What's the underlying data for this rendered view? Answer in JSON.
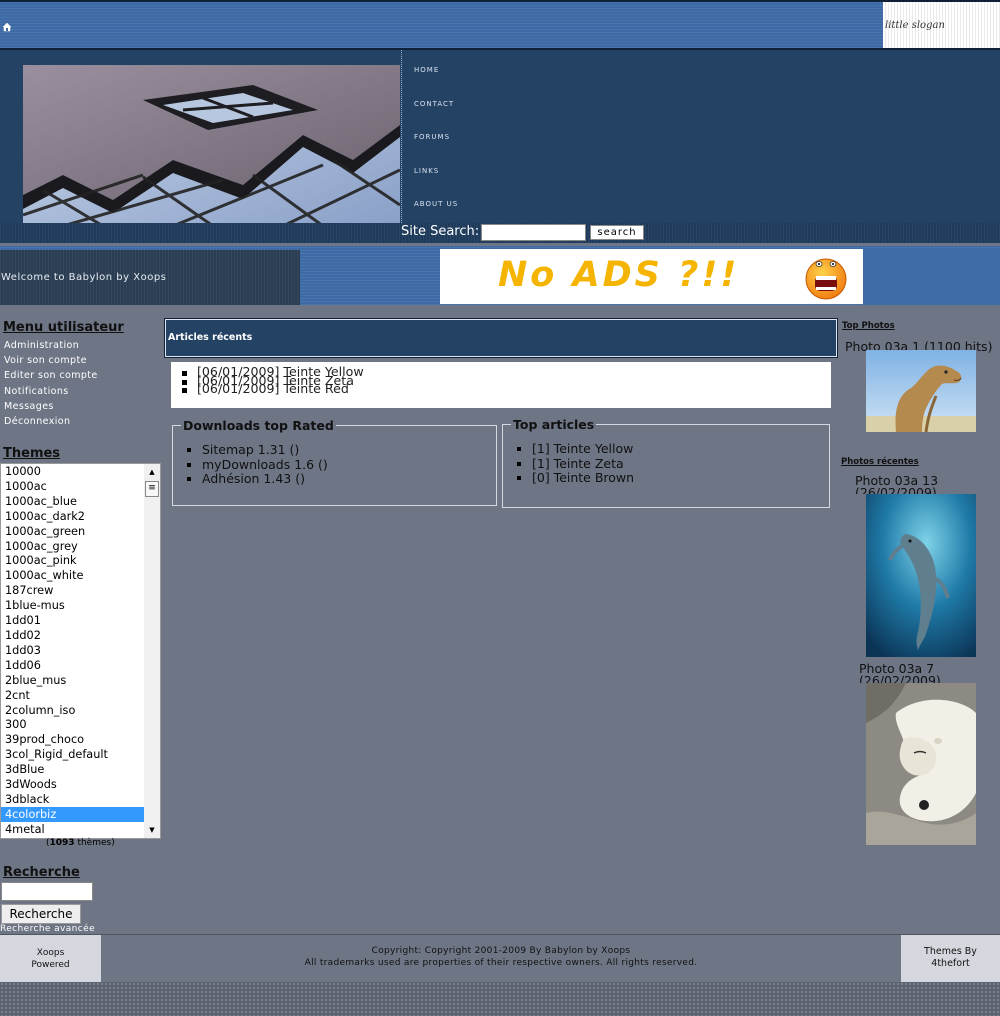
{
  "topbar": {
    "slogan": "little slogan",
    "home_icon": "home-icon"
  },
  "nav": {
    "items": [
      "Home",
      "Contact",
      "Forums",
      "Links",
      "About us"
    ]
  },
  "site_search": {
    "label": "Site Search:",
    "placeholder": "",
    "button": "search"
  },
  "welcome": {
    "text": "Welcome to Babylon by Xoops"
  },
  "ad": {
    "text": "No ADS ?!!",
    "icon": "surprised-smiley-icon"
  },
  "user_menu": {
    "title": "Menu utilisateur",
    "items": [
      "Administration",
      "Voir son compte",
      "Editer son compte",
      "Notifications",
      "Messages",
      "Déconnexion"
    ]
  },
  "themes": {
    "title": "Themes",
    "options": [
      "10000",
      "1000ac",
      "1000ac_blue",
      "1000ac_dark2",
      "1000ac_green",
      "1000ac_grey",
      "1000ac_pink",
      "1000ac_white",
      "187crew",
      "1blue-mus",
      "1dd01",
      "1dd02",
      "1dd03",
      "1dd06",
      "2blue_mus",
      "2cnt",
      "2column_iso",
      "300",
      "39prod_choco",
      "3col_Rigid_default",
      "3dBlue",
      "3dWoods",
      "3dblack",
      "4colorbiz",
      "4metal"
    ],
    "selected": "4colorbiz",
    "count": "1093",
    "count_suffix": " thèmes)",
    "count_prefix": "("
  },
  "search_block": {
    "title": "Recherche",
    "value": "",
    "button": "Recherche",
    "advanced": "Recherche avancée"
  },
  "recent_articles": {
    "title": "Articles récents",
    "items": [
      "[06/01/2009] Teinte Yellow",
      "[06/01/2009] Teinte Zeta",
      "[06/01/2009] Teinte Red"
    ]
  },
  "downloads": {
    "title": "Downloads top Rated",
    "items": [
      "Sitemap 1.31 ()",
      "myDownloads 1.6 ()",
      "Adhésion 1.43 ()"
    ]
  },
  "top_articles": {
    "title": "Top articles",
    "items": [
      "[1] Teinte Yellow",
      "[1] Teinte Zeta",
      "[0] Teinte Brown"
    ]
  },
  "top_photos": {
    "title": "Top Photos",
    "photo1_caption": "Photo 03a 1 (1100 hits)"
  },
  "recent_photos": {
    "title": "Photos récentes",
    "photo2_caption": "Photo 03a 13 (26/02/2009)",
    "photo3_caption": "Photo 03a 7 (26/02/2009)"
  },
  "footer": {
    "left_line1": "Xoops",
    "left_line2": "Powered",
    "copyright": "Copyright: Copyright 2001-2009 By Babylon by Xoops",
    "trademarks": "All trademarks used are properties of their respective owners. All rights reserved.",
    "right_line1": "Themes By",
    "right_line2": "4thefort"
  }
}
